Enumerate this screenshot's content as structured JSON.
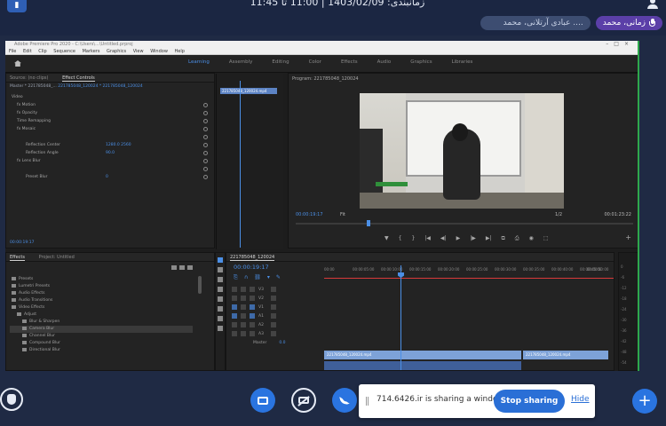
{
  "header": {
    "session_title": "زمانبندی: 1403/02/09 | 11:00 تا 11:45",
    "participants": [
      {
        "name": "عبادی آرتلانی، محمد ...."
      },
      {
        "name": "زمانی، محمد"
      }
    ]
  },
  "premiere": {
    "title_bar": "Adobe Premiere Pro 2020 - C:\\Users\\...\\Untitled.prproj",
    "menu": [
      "File",
      "Edit",
      "Clip",
      "Sequence",
      "Markers",
      "Graphics",
      "View",
      "Window",
      "Help"
    ],
    "workspaces": [
      {
        "label": "Learning",
        "active": true
      },
      {
        "label": "Assembly",
        "active": false
      },
      {
        "label": "Editing",
        "active": false
      },
      {
        "label": "Color",
        "active": false
      },
      {
        "label": "Effects",
        "active": false
      },
      {
        "label": "Audio",
        "active": false
      },
      {
        "label": "Graphics",
        "active": false
      },
      {
        "label": "Libraries",
        "active": false
      }
    ],
    "effect_controls": {
      "tabs": [
        "Source: (no clips)",
        "Effect Controls"
      ],
      "subtitle": "Master * 221785048_...",
      "subtitle_link": "221785048_120024 * 221785048_120024",
      "clip_label": "221785048_120024.mp4",
      "timecode": "00:00:19:17",
      "rows": [
        {
          "label": "Video",
          "indent": 0,
          "value": ""
        },
        {
          "label": "fx Motion",
          "indent": 1,
          "value": ""
        },
        {
          "label": "fx Opacity",
          "indent": 1,
          "value": ""
        },
        {
          "label": "Time Remapping",
          "indent": 1,
          "value": ""
        },
        {
          "label": "fx Mosaic",
          "indent": 1,
          "value": ""
        },
        {
          "label": "",
          "indent": 2,
          "value": ""
        },
        {
          "label": "Reflection Center",
          "indent": 2,
          "value": "1280.0   2560"
        },
        {
          "label": "Reflection Angle",
          "indent": 2,
          "value": "90.0"
        },
        {
          "label": "fx Lens Blur",
          "indent": 1,
          "value": ""
        },
        {
          "label": "",
          "indent": 2,
          "value": ""
        },
        {
          "label": "Preset Blur",
          "indent": 2,
          "value": "0"
        }
      ]
    },
    "program": {
      "title": "Program: 221785048_120024",
      "timecode": "00:00:19:17",
      "fit": "Fit",
      "quality": "1/2",
      "duration": "00:01:23:22",
      "transport": [
        "▼",
        "{",
        "}",
        "|◀",
        "◀|",
        "▶",
        "|▶",
        "▶|",
        "⧉",
        "⎙",
        "◉",
        "⬚"
      ],
      "add": "+"
    },
    "project": {
      "tabs": [
        "Effects",
        "Project: Untitled"
      ],
      "items": [
        {
          "label": "Presets",
          "selected": false
        },
        {
          "label": "Lumetri Presets",
          "selected": false
        },
        {
          "label": "Audio Effects",
          "selected": false
        },
        {
          "label": "Audio Transitions",
          "selected": false
        },
        {
          "label": "Video Effects",
          "selected": false
        },
        {
          "label": "Adjust",
          "selected": false
        },
        {
          "label": "Blur & Sharpen",
          "selected": false
        },
        {
          "label": "Camera Blur",
          "selected": true
        },
        {
          "label": "Channel Blur",
          "selected": false
        },
        {
          "label": "Compound Blur",
          "selected": false
        },
        {
          "label": "Directional Blur",
          "selected": false
        }
      ]
    },
    "timeline": {
      "title": "221785048_120024",
      "timecode": "00:00:19:17",
      "ruler": [
        "00:00",
        "00:00:05:00",
        "00:00:10:00",
        "00:00:15:00",
        "00:00:20:00",
        "00:00:25:00",
        "00:00:30:00",
        "00:00:35:00",
        "00:00:40:00",
        "00:00:45:00",
        "00:00:50:00"
      ],
      "tracks": [
        "V3",
        "V2",
        "V1",
        "A1",
        "A2",
        "A3"
      ],
      "clip_v1": "221785048_120024.mp4",
      "clip_v1b": "221785048_120024.mp4",
      "master_label": "Master",
      "master_value": "0.0"
    },
    "meter_scale": [
      "0",
      "-6",
      "-12",
      "-18",
      "-24",
      "-30",
      "-36",
      "-42",
      "-48",
      "-54",
      "dB"
    ]
  },
  "share_bar": {
    "message": "714.6426.ir is sharing a window.",
    "stop_label": "Stop sharing",
    "hide_label": "Hide"
  },
  "controls": {
    "plus_label": "+"
  }
}
